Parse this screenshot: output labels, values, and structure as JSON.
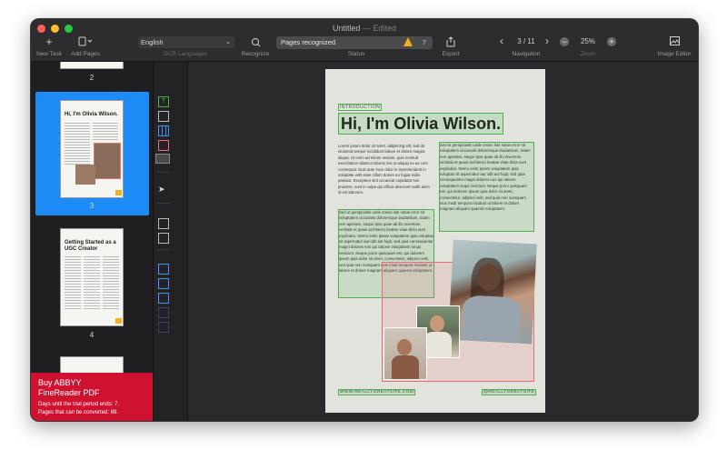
{
  "window": {
    "title": "Untitled",
    "edited": "— Edited"
  },
  "toolbar": {
    "new_task": "New Task",
    "add_pages": "Add Pages",
    "language_value": "English",
    "ocr_languages": "OCR Languages",
    "recognize": "Recognize",
    "status_value": "Pages recognized",
    "warnings_count": "7",
    "status_label": "Status",
    "export": "Export",
    "page_indicator": "3 / 11",
    "navigation": "Navigation",
    "zoom_value": "25%",
    "zoom_label": "Zoom",
    "image_editor": "Image Editor"
  },
  "sidebar": {
    "pages": [
      {
        "number": "2"
      },
      {
        "number": "3",
        "title": "Hi, I'm Olivia Wilson."
      },
      {
        "number": "4",
        "title": "Getting Started as a UGC Creator"
      }
    ],
    "trial": {
      "title_line1": "Buy ABBYY",
      "title_line2": "FineReader PDF",
      "days": "Days until the trial period ends: 7.",
      "pages": "Pages that can be converted: 89."
    }
  },
  "document": {
    "intro": "INTRODUCTION",
    "heading": "Hi, I'm Olivia Wilson.",
    "para1": "Lorem ipsum dolor sit amet, adipiscing elit, sed do eiusmod tempor incididunt labore et dolore magna aliqua. Ut enim ad minim veniam, quis nostrud exercitation ullamco laboris nisi ut aliquip ex ea com consequat. Duis aute irure dolor in reprehenderit in voluptate velit esse cillum dolore eu fugiat nulla pariatur. Excepteur sint occaecat cupidatat non proident, sunt in culpa qui officia deserunt mollit anim id est laborum.",
    "para2": "Sed ut perspiciatis unde omnis iste natus error sit voluptatem accusanti doloremque laudantium, totam rem aperiam, eaque ipsa quae ab illo inventore veritatis et quasi architecto beatae vitae dicta sunt explicabo. Nemo enim ipsam voluptatem quia voluptas sit aspernatur aut odit aut fugit, sed quia consequuntur magni dolores eos qui ratione voluptatem sequi nesciunt. Neque porro quisquam est, qui dolorem ipsum quia dolor sit amet, consectetur, adipisci velit, sed quia non numquam eius modi tempora incidunt ut labore et dolore magnam aliquam quaerat voluptatem.",
    "para3": "Sed ut perspiciatis unde omnis iste natus error sit voluptatem accusanti doloremque laudantium, totam rem aperiam, eaque ipsa quae ab illo inventore veritatis et quasi architecto beatae vitae dicta sunt explicabo. Nemo enim ipsam voluptatem quia voluptas sit aspernatur aut odit aut fugit, sed quia consequuntur magni dolores eos qui ratione voluptatem sequi nesciunt. Neque porro quisquam est, qui dolorem ipsum quia dolor sit amet, consectetur, adipisci velit, sed quia non numquam eius modi tempora incidunt ut labore et dolore magnam aliquam quaerat voluptatem.",
    "footer_left": "WWW.REALLYGREATSITE.COM",
    "footer_right": "@REALLYGREATSITE"
  },
  "colors": {
    "accent": "#1c8bf5",
    "trial_bg": "#cf1230",
    "recognized_green": "#4caf50",
    "warning": "#f2b01e"
  }
}
